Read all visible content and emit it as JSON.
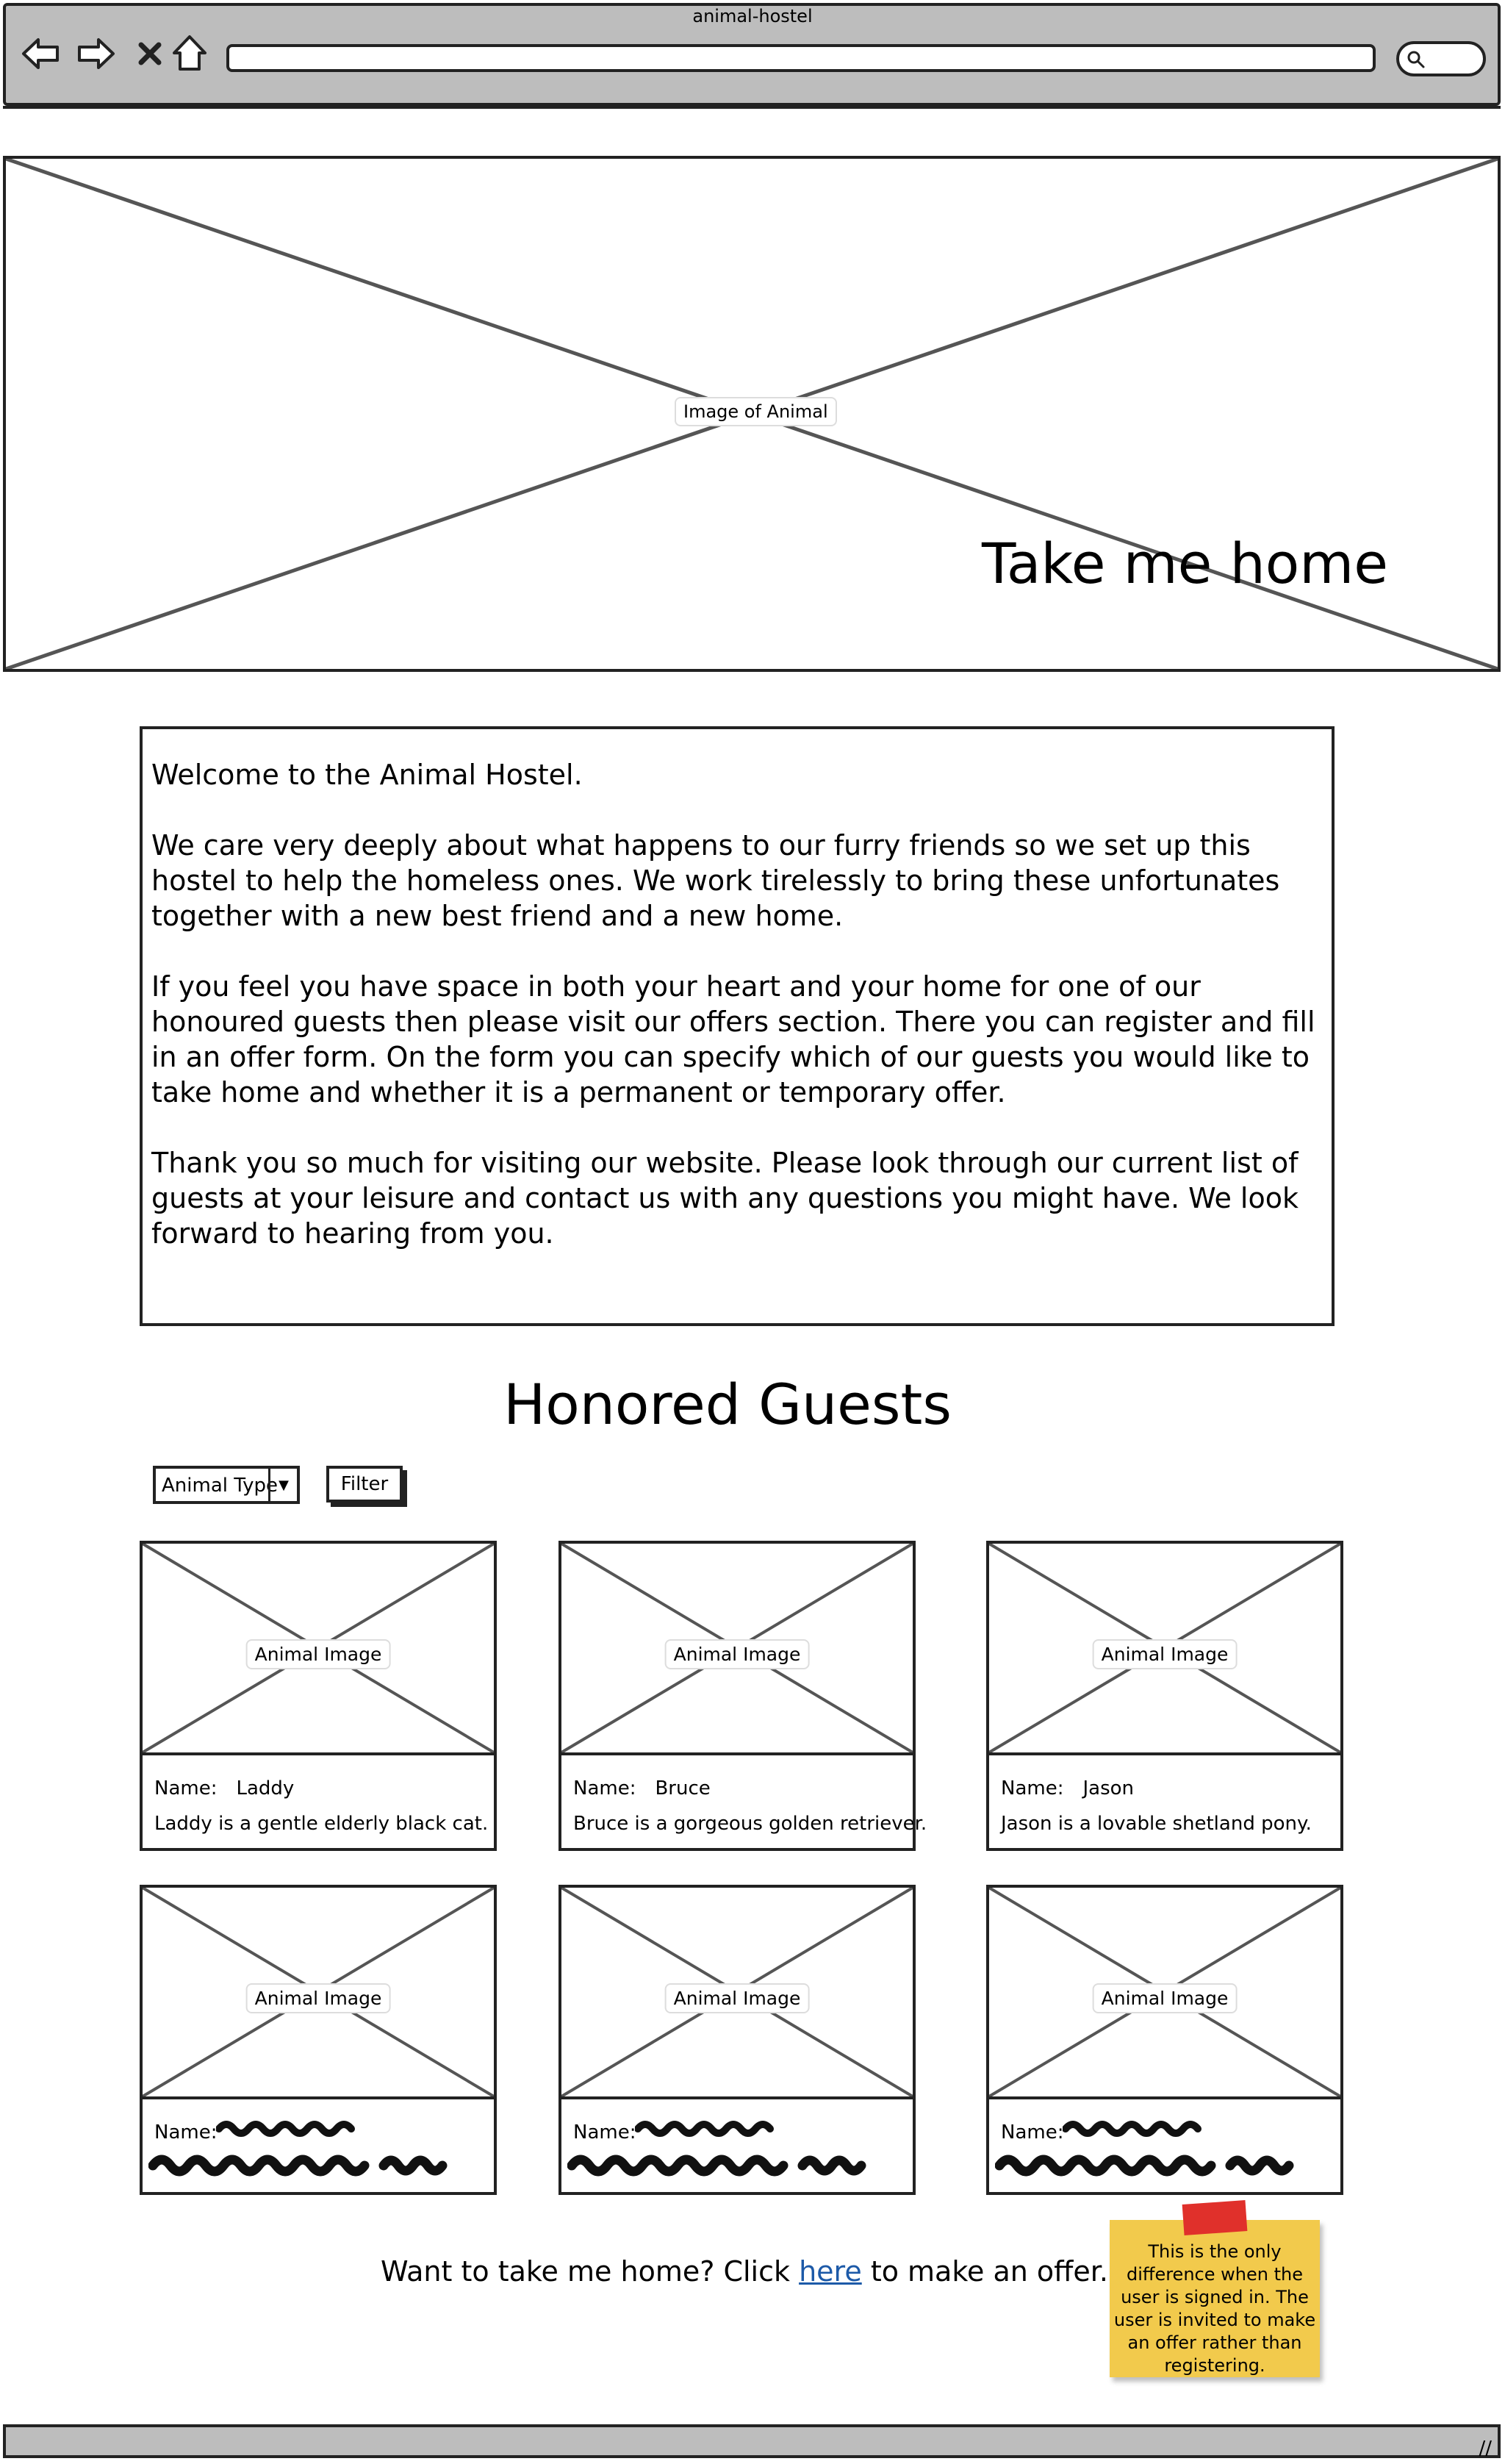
{
  "window": {
    "title": "animal-hostel"
  },
  "hero": {
    "image_label": "Image of Animal",
    "title": "Take me home"
  },
  "welcome": {
    "paragraphs": [
      "Welcome to the Animal Hostel.",
      "We care very deeply about what happens to our furry friends so we set up this hostel to help the homeless ones. We work tirelessly to bring these unfortunates together with a new best friend and a new home.",
      "If you feel you have space in both your heart and your home for one of our honoured guests then please visit our offers section. There you can register and fill in an offer form. On the form you can specify which of our guests you would like to take home and whether it is a permanent or temporary offer.",
      "Thank you so much for visiting our website. Please look through our current list of guests at your leisure and contact us with any questions you might have. We look forward to hearing from you."
    ]
  },
  "guests": {
    "title": "Honored Guests",
    "filter_select": "Animal Type",
    "filter_button": "Filter",
    "image_label": "Animal Image",
    "name_label": "Name:",
    "cards": [
      {
        "name": "Laddy",
        "description": "Laddy is a gentle elderly black cat."
      },
      {
        "name": "Bruce",
        "description": "Bruce is a gorgeous golden retriever."
      },
      {
        "name": "Jason",
        "description": "Jason is a lovable shetland pony."
      },
      {
        "name": "",
        "description": ""
      },
      {
        "name": "",
        "description": ""
      },
      {
        "name": "",
        "description": ""
      }
    ]
  },
  "offer": {
    "prefix": "Want to take me home? Click ",
    "link": "here",
    "suffix": " to make an offer."
  },
  "sticky_note": "This is the only difference when the user is signed in. The user is invited to make an offer rather than registering."
}
